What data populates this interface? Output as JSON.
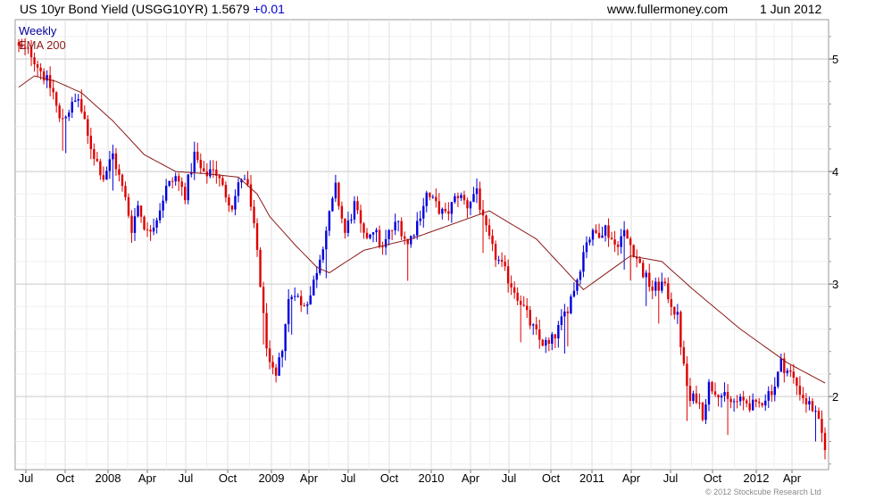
{
  "header": {
    "title": "US 10yr Bond Yield (USGG10YR)",
    "last": "1.5679",
    "change": "+0.01",
    "site": "www.fullermoney.com",
    "date": "1 Jun 2012"
  },
  "copyright": "© 2012 Stockcube Research Ltd",
  "colors": {
    "up": "#0000dd",
    "down": "#dd0000",
    "ema": "#8b1a1a",
    "grid": "#dddddd",
    "border": "#999999",
    "legend_weekly": "#000099",
    "legend_ema": "#8b1a1a"
  },
  "chart_data": {
    "type": "candlestick",
    "legend": [
      {
        "label": "Weekly",
        "color": "#000099"
      },
      {
        "label": "EMA 200",
        "color": "#8b1a1a"
      }
    ],
    "x_ticks": [
      "Jul",
      "Oct",
      "2008",
      "Apr",
      "Jul",
      "Oct",
      "2009",
      "Apr",
      "Jul",
      "Oct",
      "2010",
      "Apr",
      "Jul",
      "Oct",
      "2011",
      "Apr",
      "Jul",
      "Oct",
      "2012",
      "Apr"
    ],
    "y_ticks": [
      2,
      3,
      4,
      5
    ],
    "ylim": [
      1.35,
      5.35
    ],
    "weeks": 258,
    "close_anchors": [
      [
        0,
        5.1
      ],
      [
        4,
        5.05
      ],
      [
        7,
        4.9
      ],
      [
        11,
        4.7
      ],
      [
        13,
        4.45
      ],
      [
        16,
        4.55
      ],
      [
        19,
        4.65
      ],
      [
        22,
        4.3
      ],
      [
        24,
        4.15
      ],
      [
        27,
        3.95
      ],
      [
        30,
        4.15
      ],
      [
        34,
        3.75
      ],
      [
        36,
        3.5
      ],
      [
        38,
        3.7
      ],
      [
        41,
        3.45
      ],
      [
        44,
        3.6
      ],
      [
        47,
        3.85
      ],
      [
        50,
        3.95
      ],
      [
        53,
        3.8
      ],
      [
        56,
        4.15
      ],
      [
        59,
        3.95
      ],
      [
        62,
        4.05
      ],
      [
        65,
        3.85
      ],
      [
        68,
        3.7
      ],
      [
        71,
        3.95
      ],
      [
        73,
        3.85
      ],
      [
        76,
        3.3
      ],
      [
        78,
        2.7
      ],
      [
        80,
        2.25
      ],
      [
        82,
        2.15
      ],
      [
        84,
        2.45
      ],
      [
        86,
        2.85
      ],
      [
        88,
        2.95
      ],
      [
        90,
        2.8
      ],
      [
        93,
        2.9
      ],
      [
        96,
        3.25
      ],
      [
        99,
        3.6
      ],
      [
        101,
        3.85
      ],
      [
        104,
        3.45
      ],
      [
        107,
        3.7
      ],
      [
        110,
        3.4
      ],
      [
        113,
        3.5
      ],
      [
        116,
        3.3
      ],
      [
        118,
        3.45
      ],
      [
        121,
        3.55
      ],
      [
        124,
        3.35
      ],
      [
        127,
        3.55
      ],
      [
        130,
        3.8
      ],
      [
        133,
        3.7
      ],
      [
        136,
        3.6
      ],
      [
        140,
        3.8
      ],
      [
        143,
        3.7
      ],
      [
        146,
        3.85
      ],
      [
        148,
        3.55
      ],
      [
        151,
        3.3
      ],
      [
        154,
        3.15
      ],
      [
        157,
        3.0
      ],
      [
        160,
        2.85
      ],
      [
        163,
        2.65
      ],
      [
        166,
        2.5
      ],
      [
        169,
        2.45
      ],
      [
        172,
        2.6
      ],
      [
        175,
        2.8
      ],
      [
        178,
        3.05
      ],
      [
        181,
        3.4
      ],
      [
        184,
        3.45
      ],
      [
        187,
        3.5
      ],
      [
        190,
        3.35
      ],
      [
        193,
        3.45
      ],
      [
        196,
        3.3
      ],
      [
        199,
        3.1
      ],
      [
        202,
        2.95
      ],
      [
        205,
        3.0
      ],
      [
        207,
        2.9
      ],
      [
        210,
        2.7
      ],
      [
        212,
        2.25
      ],
      [
        214,
        1.95
      ],
      [
        216,
        2.0
      ],
      [
        218,
        1.85
      ],
      [
        220,
        2.1
      ],
      [
        223,
        2.05
      ],
      [
        226,
        1.95
      ],
      [
        229,
        1.95
      ],
      [
        232,
        1.95
      ],
      [
        235,
        1.9
      ],
      [
        238,
        2.0
      ],
      [
        241,
        2.1
      ],
      [
        243,
        2.3
      ],
      [
        246,
        2.2
      ],
      [
        249,
        2.05
      ],
      [
        251,
        1.95
      ],
      [
        253,
        1.9
      ],
      [
        255,
        1.75
      ],
      [
        257,
        1.57
      ]
    ],
    "ema_anchors": [
      [
        0,
        4.75
      ],
      [
        5,
        4.85
      ],
      [
        12,
        4.8
      ],
      [
        20,
        4.7
      ],
      [
        30,
        4.45
      ],
      [
        40,
        4.15
      ],
      [
        50,
        4.0
      ],
      [
        60,
        3.98
      ],
      [
        70,
        3.95
      ],
      [
        76,
        3.8
      ],
      [
        80,
        3.6
      ],
      [
        88,
        3.35
      ],
      [
        95,
        3.15
      ],
      [
        99,
        3.1
      ],
      [
        110,
        3.3
      ],
      [
        125,
        3.4
      ],
      [
        135,
        3.5
      ],
      [
        145,
        3.6
      ],
      [
        150,
        3.65
      ],
      [
        165,
        3.4
      ],
      [
        175,
        3.1
      ],
      [
        180,
        2.95
      ],
      [
        195,
        3.25
      ],
      [
        205,
        3.2
      ],
      [
        215,
        2.95
      ],
      [
        230,
        2.6
      ],
      [
        245,
        2.3
      ],
      [
        257,
        2.12
      ]
    ]
  }
}
